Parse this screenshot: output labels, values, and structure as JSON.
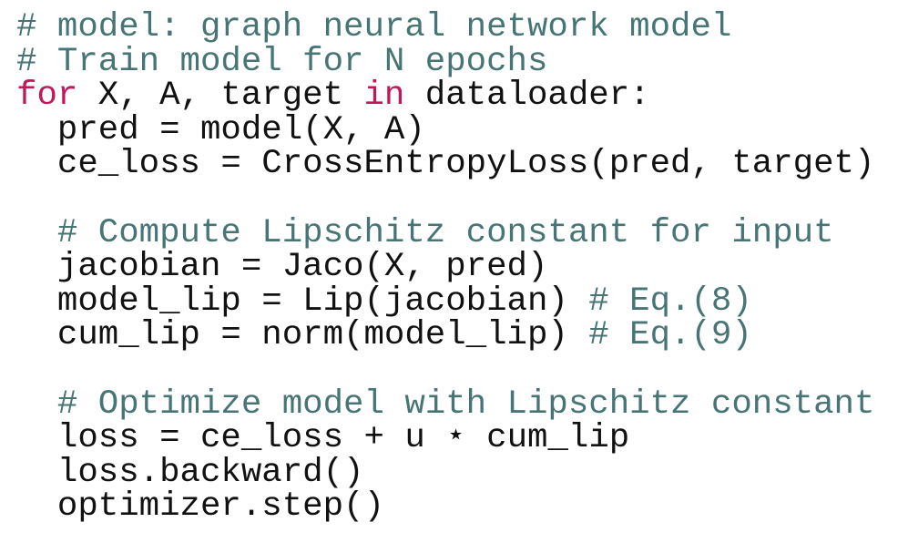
{
  "code": {
    "line1": {
      "comment": "# model: graph neural network model"
    },
    "line2": {
      "comment": "# Train model for N epochs"
    },
    "line3": {
      "kw_for": "for",
      "t1": " X, A, target ",
      "kw_in": "in",
      "t2": " dataloader:"
    },
    "line4": {
      "text": "  pred = model(X, A)"
    },
    "line5": {
      "text": "  ce_loss = CrossEntropyLoss(pred, target)"
    },
    "line7": {
      "comment": "  # Compute Lipschitz constant for input"
    },
    "line8": {
      "text": "  jacobian = Jaco(X, pred)"
    },
    "line9": {
      "text": "  model_lip = Lip(jacobian) ",
      "comment": "# Eq.(8)"
    },
    "line10": {
      "text": "  cum_lip = norm(model_lip) ",
      "comment": "# Eq.(9)"
    },
    "line12": {
      "comment": "  # Optimize model with Lipschitz constant"
    },
    "line13": {
      "text": "  loss = ce_loss + u ⋆ cum_lip"
    },
    "line14": {
      "text": "  loss.backward()"
    },
    "line15": {
      "text": "  optimizer.step()"
    }
  },
  "colors": {
    "comment": "#477575",
    "keyword": "#c2185b",
    "text": "#111111",
    "background": "#ffffff"
  }
}
